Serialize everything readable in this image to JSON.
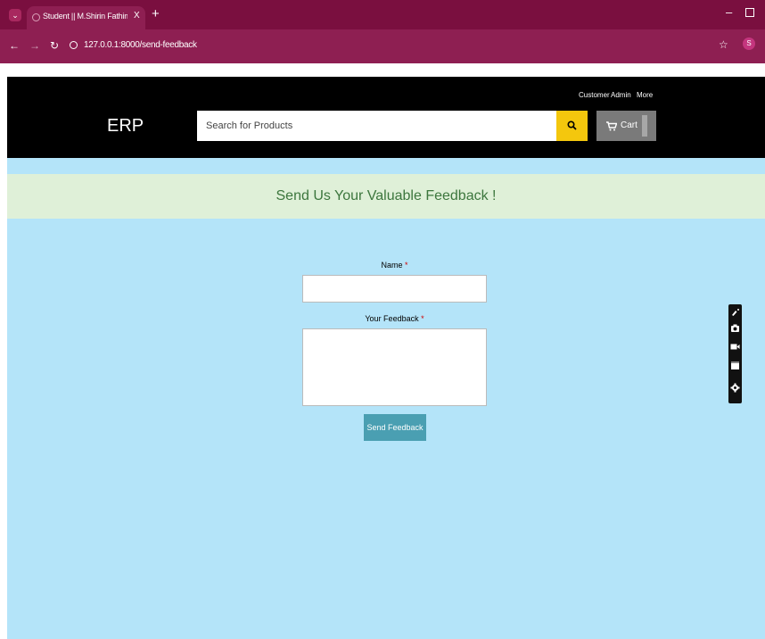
{
  "browser": {
    "tab_title": "Student || M.Shirin Fathima Scr",
    "tab_close": "X",
    "new_tab": "+",
    "url": "127.0.0.1:8000/send-feedback",
    "profile_initial": "S",
    "colors": {
      "tabbar": "#7a0f3f",
      "toolbar": "#8e1f52"
    }
  },
  "header": {
    "logo": "ERP",
    "top_links": [
      "Customer",
      "Admin",
      "More"
    ],
    "search_placeholder": "Search for Products",
    "cart_label": "Cart",
    "colors": {
      "search_button": "#f4c70d",
      "cart_button": "#7a7a7a"
    }
  },
  "banner": {
    "title": "Send Us Your Valuable Feedback !",
    "colors": {
      "background": "#dff0d8",
      "text": "#3c763d"
    }
  },
  "form": {
    "name_label": "Name",
    "feedback_label": "Your Feedback",
    "required_mark": "*",
    "name_value": "",
    "feedback_value": "",
    "submit_label": "Send Feedback",
    "colors": {
      "page_background": "#b4e4f9",
      "submit": "#4a9fb2"
    }
  },
  "side_toolbar": {
    "icons": [
      "brush-icon",
      "camera-icon",
      "video-icon",
      "window-icon",
      "gear-icon"
    ]
  }
}
